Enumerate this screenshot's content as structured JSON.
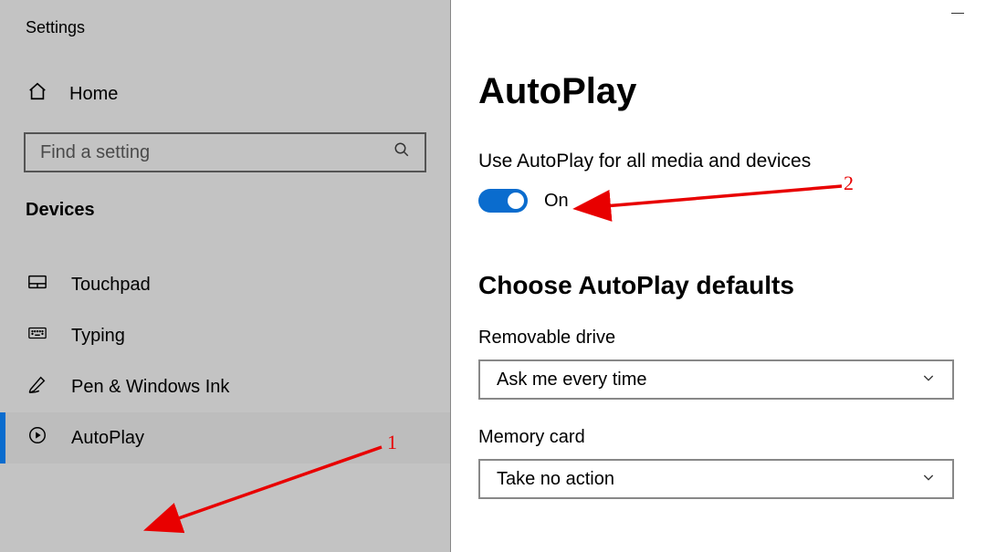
{
  "window_title": "Settings",
  "sidebar": {
    "home_label": "Home",
    "search_placeholder": "Find a setting",
    "category": "Devices",
    "items": [
      {
        "label": "Touchpad",
        "icon": "touchpad-icon",
        "active": false
      },
      {
        "label": "Typing",
        "icon": "keyboard-icon",
        "active": false
      },
      {
        "label": "Pen & Windows Ink",
        "icon": "pen-icon",
        "active": false
      },
      {
        "label": "AutoPlay",
        "icon": "autoplay-icon",
        "active": true
      }
    ]
  },
  "main": {
    "title": "AutoPlay",
    "toggle": {
      "label": "Use AutoPlay for all media and devices",
      "state_text": "On",
      "on": true
    },
    "defaults_heading": "Choose AutoPlay defaults",
    "removable": {
      "label": "Removable drive",
      "value": "Ask me every time"
    },
    "memory": {
      "label": "Memory card",
      "value": "Take no action"
    }
  },
  "annotations": {
    "one": "1",
    "two": "2"
  },
  "colors": {
    "accent": "#0a6cce",
    "annotation": "#e80000",
    "dim_bg": "#c3c3c3"
  }
}
